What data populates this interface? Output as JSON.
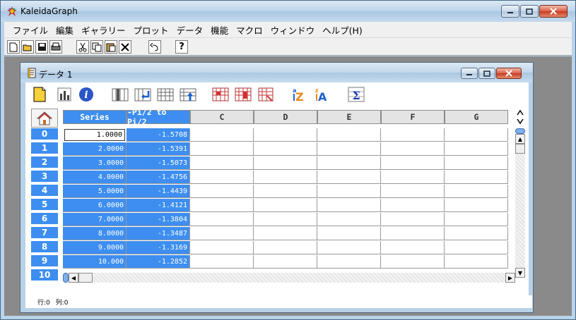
{
  "app": {
    "title": "KaleidaGraph"
  },
  "menubar": {
    "items": [
      "ファイル",
      "編集",
      "ギャラリー",
      "プロット",
      "データ",
      "機能",
      "マクロ",
      "ウィンドウ",
      "ヘルプ(H)"
    ]
  },
  "toolbar": {
    "buttons": [
      "new-icon",
      "open-icon",
      "save-icon",
      "print-icon",
      "cut-icon",
      "copy-icon",
      "paste-icon",
      "delete-icon",
      "undo-icon",
      "help-icon"
    ],
    "help_label": "?"
  },
  "data_window": {
    "title": "データ 1",
    "tools": [
      "notes-icon",
      "plot-icon",
      "info-icon",
      "insert-col-icon",
      "delete-col-icon",
      "insert-row-icon",
      "delete-row-icon",
      "fill-icon",
      "select-icon",
      "clear-icon",
      "sort-az-icon",
      "sort-za-icon",
      "sum-icon"
    ],
    "columns": [
      "Series",
      "-Pi/2 to Pi/2",
      "C",
      "D",
      "E",
      "F",
      "G"
    ],
    "row_headers": [
      "0",
      "1",
      "2",
      "3",
      "4",
      "5",
      "6",
      "7",
      "8",
      "9",
      "10"
    ],
    "rows": [
      [
        "1.0000",
        "-1.5708"
      ],
      [
        "2.0000",
        "-1.5391"
      ],
      [
        "3.0000",
        "-1.5073"
      ],
      [
        "4.0000",
        "-1.4756"
      ],
      [
        "5.0000",
        "-1.4439"
      ],
      [
        "6.0000",
        "-1.4121"
      ],
      [
        "7.0000",
        "-1.3804"
      ],
      [
        "8.0000",
        "-1.3487"
      ],
      [
        "9.0000",
        "-1.3169"
      ],
      [
        "10.000",
        "-1.2852"
      ]
    ],
    "status": {
      "row": "行:0",
      "col": "列:0"
    }
  }
}
